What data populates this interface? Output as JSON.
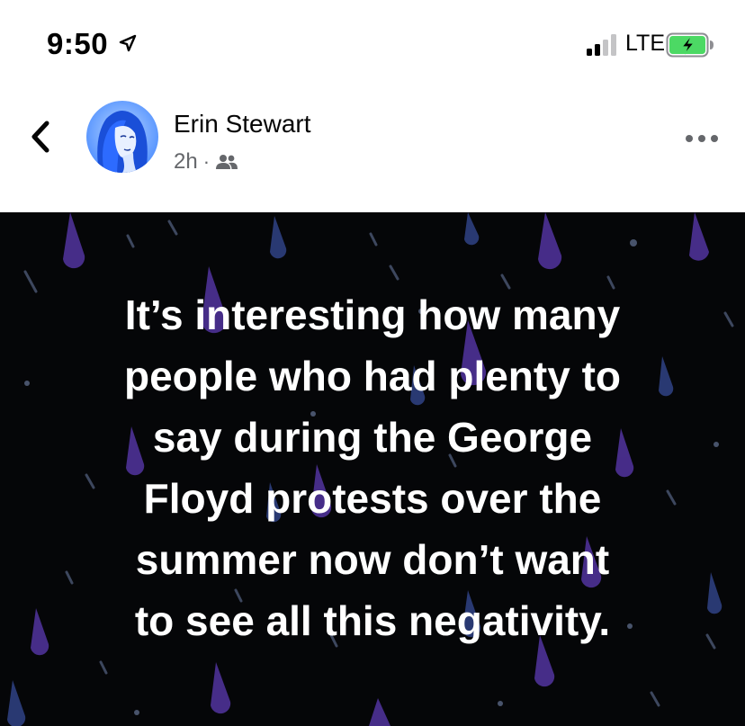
{
  "status_bar": {
    "time": "9:50",
    "network": "LTE",
    "icons": [
      "location-arrow-icon",
      "signal-icon",
      "battery-charging-icon"
    ],
    "battery_color": "#4cd964"
  },
  "post": {
    "author": "Erin Stewart",
    "time": "2h",
    "separator": "·",
    "audience_icon": "friends-icon",
    "text": "It’s interesting how many\npeople who had plenty to\nsay during the George\nFloyd protests over the\nsummer now don’t want\nto see all this negativity.",
    "background": "#050608",
    "drop_colors": [
      "#4a2f8f",
      "#2a3a7a",
      "#3a4868"
    ]
  },
  "icons": {
    "back": "chevron-left-icon",
    "more": "more-dots-icon",
    "avatar": "avatar-image"
  }
}
